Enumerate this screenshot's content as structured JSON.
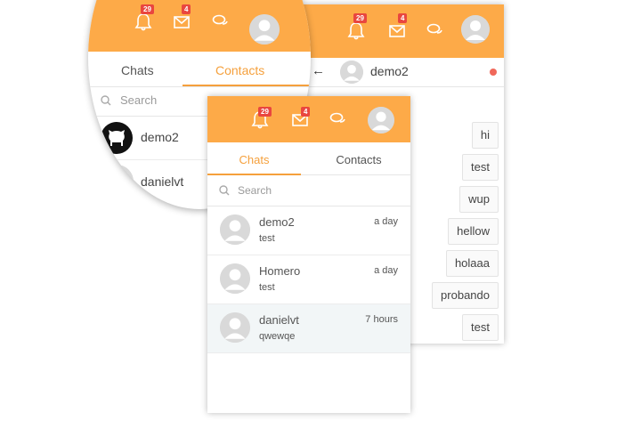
{
  "colors": {
    "accent": "#fdaa48",
    "badge": "#e9463f",
    "status_dot": "#f0685a",
    "selected_row": "#f2f6f7"
  },
  "header": {
    "notifications_badge": "29",
    "messages_badge": "4",
    "icons": [
      "bell-icon",
      "envelope-icon",
      "chat-bubbles-icon",
      "user-avatar"
    ]
  },
  "zoom": {
    "notifications_badge": "29",
    "messages_badge": "4",
    "tabs": [
      "Chats",
      "Contacts"
    ],
    "active_tab": "Contacts",
    "search_placeholder": "Search",
    "contacts": [
      {
        "name": "demo2",
        "avatar": "github-icon"
      },
      {
        "name": "danielvt",
        "avatar": "user-avatar"
      }
    ]
  },
  "chat_list": {
    "tabs": [
      "Chats",
      "Contacts"
    ],
    "active_tab": "Chats",
    "search_placeholder": "Search",
    "rows": [
      {
        "name": "demo2",
        "time": "a day",
        "message": "test"
      },
      {
        "name": "Homero",
        "time": "a day",
        "message": "test"
      },
      {
        "name": "danielvt",
        "time": "7 hours",
        "message": "qwewqe"
      }
    ]
  },
  "conversation": {
    "contact_name": "demo2",
    "messages": [
      "hi",
      "test",
      "wup",
      "hellow",
      "holaaa",
      "probando",
      "test"
    ]
  }
}
